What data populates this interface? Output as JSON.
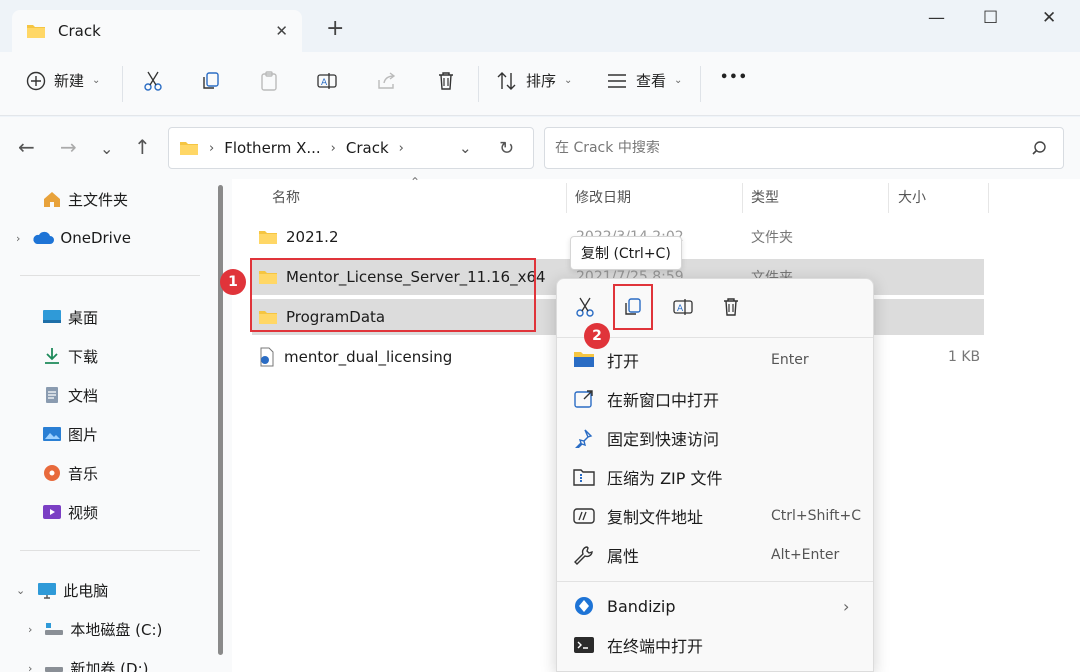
{
  "window": {
    "tab_title": "Crack",
    "tab_close": "✕",
    "new_tab": "+",
    "minimize": "—",
    "maximize": "☐",
    "close": "✕"
  },
  "toolbar": {
    "new_label": "新建",
    "sort_label": "排序",
    "view_label": "查看",
    "more_label": "•••"
  },
  "address": {
    "segments": [
      "Flotherm X...",
      "Crack"
    ],
    "search_placeholder": "在 Crack 中搜索"
  },
  "sidebar": {
    "home": "主文件夹",
    "onedrive": "OneDrive",
    "quick": [
      "桌面",
      "下载",
      "文档",
      "图片",
      "音乐",
      "视频"
    ],
    "this_pc": "此电脑",
    "drives": [
      "本地磁盘 (C:)",
      "新加卷 (D:)"
    ]
  },
  "columns": {
    "name": "名称",
    "modified": "修改日期",
    "type": "类型",
    "size": "大小"
  },
  "files": [
    {
      "name": "2021.2",
      "modified": "2022/3/14 2:02",
      "type": "文件夹",
      "size": ""
    },
    {
      "name": "Mentor_License_Server_11.16_x64",
      "modified": "2021/7/25 8:59",
      "type": "文件夹",
      "size": ""
    },
    {
      "name": "ProgramData",
      "modified": "",
      "type": "",
      "size": ""
    },
    {
      "name": "mentor_dual_licensing",
      "modified": "",
      "type": "",
      "size": "1 KB"
    }
  ],
  "badges": {
    "step1": "1",
    "step2": "2"
  },
  "tooltip": "复制 (Ctrl+C)",
  "context_menu": {
    "items": [
      {
        "label": "打开",
        "shortcut": "Enter",
        "icon": "folder-open-icon"
      },
      {
        "label": "在新窗口中打开",
        "shortcut": "",
        "icon": "new-window-icon"
      },
      {
        "label": "固定到快速访问",
        "shortcut": "",
        "icon": "pin-icon"
      },
      {
        "label": "压缩为 ZIP 文件",
        "shortcut": "",
        "icon": "zip-icon"
      },
      {
        "label": "复制文件地址",
        "shortcut": "Ctrl+Shift+C",
        "icon": "copy-path-icon"
      },
      {
        "label": "属性",
        "shortcut": "Alt+Enter",
        "icon": "wrench-icon"
      },
      {
        "label": "Bandizip",
        "shortcut": "",
        "icon": "bandizip-icon"
      },
      {
        "label": "在终端中打开",
        "shortcut": "",
        "icon": "terminal-icon"
      }
    ]
  },
  "colors": {
    "accent": "#0067c0",
    "folder": "#f5c542",
    "highlight": "#e0343a",
    "selection": "#dcdcdc"
  }
}
